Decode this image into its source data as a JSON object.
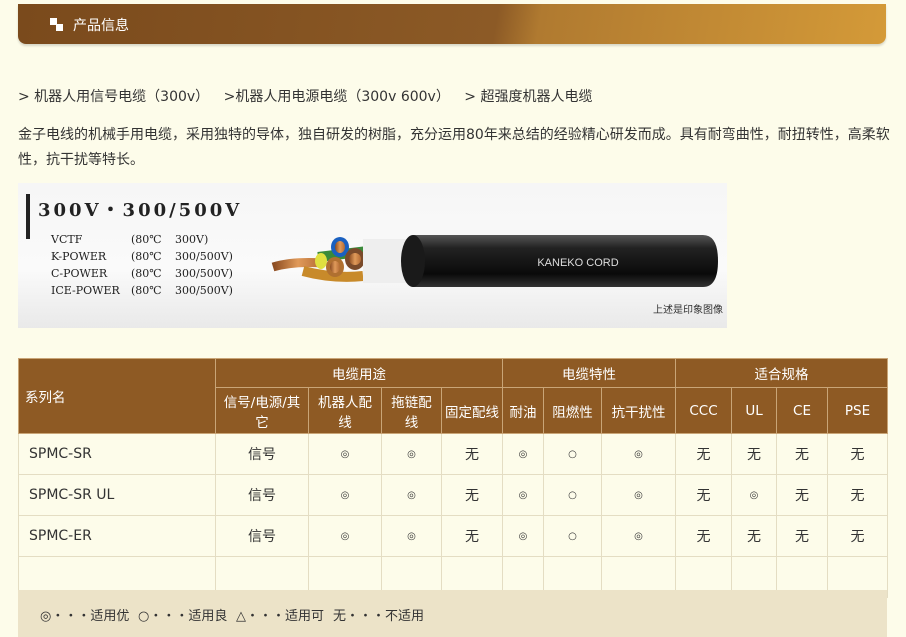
{
  "header": {
    "title": "产品信息"
  },
  "breadcrumbs": [
    "> 机器人用信号电缆（300v）",
    ">机器人用电源电缆（300v 600v）",
    "> 超强度机器人电缆"
  ],
  "description": "金子电线的机械手用电缆，采用独特的导体，独自研发的树脂，充分运用80年来总结的经验精心研发而成。具有耐弯曲性，耐扭转性，高柔软性，抗干扰等特长。",
  "banner": {
    "heading": "300V・300/500V",
    "specs": [
      {
        "name": "VCTF",
        "temp": "(80℃",
        "volt": "300V)"
      },
      {
        "name": "K-POWER",
        "temp": "(80℃",
        "volt": "300/500V)"
      },
      {
        "name": "C-POWER",
        "temp": "(80℃",
        "volt": "300/500V)"
      },
      {
        "name": "ICE-POWER",
        "temp": "(80℃",
        "volt": "300/500V)"
      }
    ],
    "cable_print": "KANEKO CORD",
    "note": "上述是印象图像"
  },
  "table": {
    "series_header": "系列名",
    "groups": [
      "电缆用途",
      "电缆特性",
      "适合规格"
    ],
    "columns": [
      "信号/电源/其它",
      "机器人配线",
      "拖链配线",
      "固定配线",
      "耐油",
      "阻燃性",
      "抗干扰性",
      "CCC",
      "UL",
      "CE",
      "PSE"
    ],
    "rows": [
      {
        "name": "SPMC-SR",
        "cells": [
          "信号",
          "◎",
          "◎",
          "无",
          "◎",
          "○",
          "◎",
          "无",
          "无",
          "无",
          "无"
        ]
      },
      {
        "name": "SPMC-SR UL",
        "cells": [
          "信号",
          "◎",
          "◎",
          "无",
          "◎",
          "○",
          "◎",
          "无",
          "◎",
          "无",
          "无"
        ]
      },
      {
        "name": "SPMC-ER",
        "cells": [
          "信号",
          "◎",
          "◎",
          "无",
          "◎",
          "○",
          "◎",
          "无",
          "无",
          "无",
          "无"
        ]
      },
      {
        "name": "",
        "cells": [
          "",
          "",
          "",
          "",
          "",
          "",
          "",
          "",
          "",
          "",
          ""
        ]
      }
    ]
  },
  "legend": [
    "◎・・・适用优",
    "○・・・适用良",
    "△・・・适用可",
    "无・・・不适用"
  ]
}
